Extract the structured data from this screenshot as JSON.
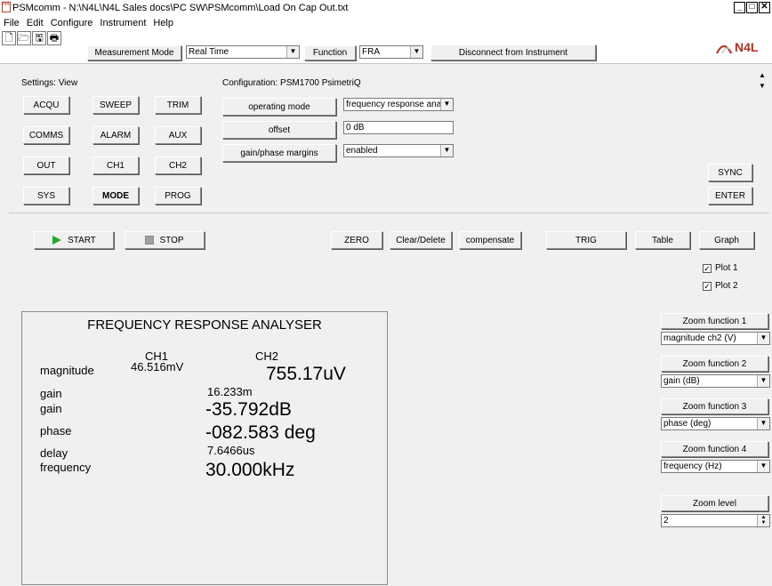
{
  "window": {
    "title": "PSMcomm - N:\\N4L\\N4L Sales docs\\PC SW\\PSMcomm\\Load On Cap Out.txt",
    "app_icon_text": "N4L",
    "minimize": "_",
    "maximize": "□",
    "close": "✕"
  },
  "menu": {
    "items": [
      "File",
      "Edit",
      "Configure",
      "Instrument",
      "Help"
    ]
  },
  "toolbar": {
    "icons": [
      "new-file-icon",
      "open-folder-icon",
      "save-icon",
      "print-icon"
    ],
    "icon_glyphs": [
      "🗋",
      "🗁",
      "🖫",
      "🖶"
    ],
    "measurement_mode_label": "Measurement Mode",
    "measurement_mode_value": "Real Time",
    "function_label": "Function",
    "function_value": "FRA",
    "disconnect_label": "Disconnect from Instrument",
    "logo_text": "N4L"
  },
  "settings": {
    "title": "Settings: View",
    "buttons": [
      "ACQU",
      "SWEEP",
      "TRIM",
      "COMMS",
      "ALARM",
      "AUX",
      "OUT",
      "CH1",
      "CH2",
      "SYS",
      "MODE",
      "PROG"
    ]
  },
  "configuration": {
    "title": "Configuration: PSM1700 PsimetriQ",
    "operating_mode_label": "operating mode",
    "operating_mode_value": "frequency response analy",
    "offset_label": "offset",
    "offset_value": "0 dB",
    "gain_phase_label": "gain/phase margins",
    "gain_phase_value": "enabled"
  },
  "right_buttons": {
    "sync": "SYNC",
    "enter": "ENTER"
  },
  "controls": {
    "start": "START",
    "stop": "STOP",
    "zero": "ZERO",
    "clear_delete": "Clear/Delete",
    "compensate": "compensate",
    "trig": "TRIG",
    "table": "Table",
    "graph": "Graph",
    "plot1": "Plot 1",
    "plot2": "Plot 2",
    "plot1_checked": true,
    "plot2_checked": true,
    "check_glyph": "✓"
  },
  "fra": {
    "title": "FREQUENCY RESPONSE ANALYSER",
    "ch1_header": "CH1",
    "ch2_header": "CH2",
    "magnitude_label": "magnitude",
    "magnitude_ch1": "46.516mV",
    "magnitude_ch2": "755.17uV",
    "gain_label_1": "gain",
    "gain_value_1": "16.233m",
    "gain_label_2": "gain",
    "gain_value_2": "-35.792dB",
    "phase_label": "phase",
    "phase_value": "-082.583 deg",
    "delay_label": "delay",
    "delay_value": "7.6466us",
    "frequency_label": "frequency",
    "frequency_value": "30.000kHz"
  },
  "zoom": {
    "f1_label": "Zoom function 1",
    "f1_value": "magnitude ch2 (V)",
    "f2_label": "Zoom function 2",
    "f2_value": "gain (dB)",
    "f3_label": "Zoom function 3",
    "f3_value": "phase (deg)",
    "f4_label": "Zoom function 4",
    "f4_value": "frequency (Hz)",
    "level_label": "Zoom level",
    "level_value": "2"
  },
  "colors": {
    "start_green": "#22aa22",
    "stop_gray": "#a0a0a0",
    "logo_red": "#b03020"
  }
}
